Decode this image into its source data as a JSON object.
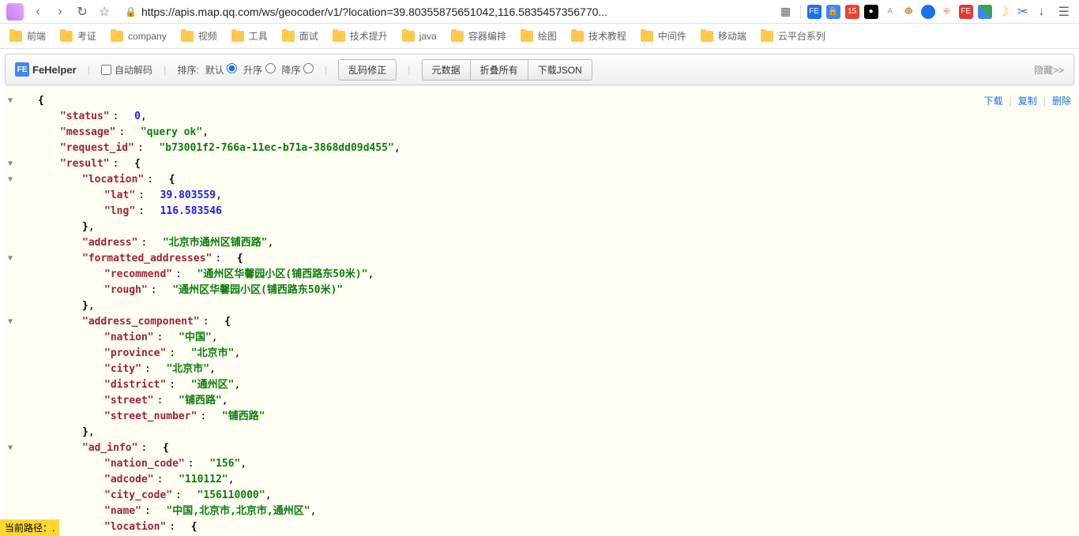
{
  "browser": {
    "url": "https://apis.map.qq.com/ws/geocoder/v1/?location=39.80355875651042,116.5835457356770..."
  },
  "bookmarks": [
    "前端",
    "考证",
    "company",
    "视频",
    "工具",
    "面试",
    "技术提升",
    "java",
    "容器编排",
    "绘图",
    "技术教程",
    "中间件",
    "移动端",
    "云平台系列"
  ],
  "fehelper": {
    "name": "FeHelper",
    "auto_decode": "自动解码",
    "sort_label": "排序:",
    "sort_default": "默认",
    "sort_asc": "升序",
    "sort_desc": "降序",
    "fix_garbled": "乱码修正",
    "raw_data": "元数据",
    "collapse_all": "折叠所有",
    "download_json": "下载JSON",
    "hide": "隐藏>>"
  },
  "json_actions": {
    "download": "下载",
    "copy": "复制",
    "delete": "删除"
  },
  "json": {
    "status_key": "status",
    "status_val": "0",
    "message_key": "message",
    "message_val": "query ok",
    "request_id_key": "request_id",
    "request_id_val": "b73001f2-766a-11ec-b71a-3868dd09d455",
    "result_key": "result",
    "location_key": "location",
    "lat_key": "lat",
    "lat_val": "39.803559",
    "lng_key": "lng",
    "lng_val": "116.583546",
    "address_key": "address",
    "address_val": "北京市通州区铺西路",
    "formatted_addresses_key": "formatted_addresses",
    "recommend_key": "recommend",
    "recommend_val": "通州区华馨园小区(铺西路东50米)",
    "rough_key": "rough",
    "rough_val": "通州区华馨园小区(铺西路东50米)",
    "address_component_key": "address_component",
    "nation_key": "nation",
    "nation_val": "中国",
    "province_key": "province",
    "province_val": "北京市",
    "city_key": "city",
    "city_val": "北京市",
    "district_key": "district",
    "district_val": "通州区",
    "street_key": "street",
    "street_val": "铺西路",
    "street_number_key": "street_number",
    "street_number_val": "铺西路",
    "ad_info_key": "ad_info",
    "nation_code_key": "nation_code",
    "nation_code_val": "156",
    "adcode_key": "adcode",
    "adcode_val": "110112",
    "city_code_key": "city_code",
    "city_code_val": "156110000",
    "name_key": "name",
    "name_val": "中国,北京市,北京市,通州区",
    "location2_key": "location"
  },
  "path_overlay": "当前路径：."
}
